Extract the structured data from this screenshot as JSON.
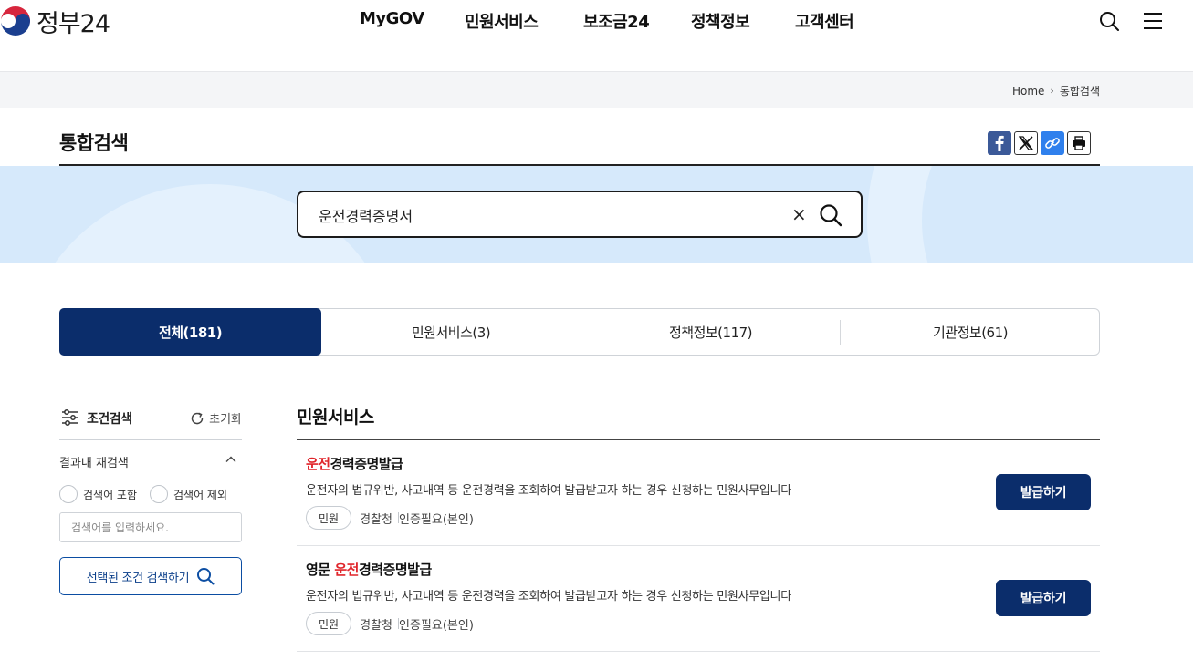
{
  "header": {
    "logo_text": "정부24",
    "nav": [
      "MyGOV",
      "민원서비스",
      "보조금24",
      "정책정보",
      "고객센터"
    ],
    "icons": [
      "search-icon",
      "menu-icon"
    ]
  },
  "breadcrumb": {
    "home": "Home",
    "current": "통합검색"
  },
  "page": {
    "title": "통합검색",
    "share_icons": [
      "facebook-icon",
      "x-icon",
      "link-icon",
      "print-icon"
    ]
  },
  "search": {
    "value": "운전경력증명서"
  },
  "tabs": [
    {
      "label": "전체(181)",
      "active": true
    },
    {
      "label": "민원서비스(3)",
      "active": false
    },
    {
      "label": "정책정보(117)",
      "active": false
    },
    {
      "label": "기관정보(61)",
      "active": false
    }
  ],
  "filter": {
    "title": "조건검색",
    "reset_label": "초기화",
    "refine_label": "결과내 재검색",
    "radio_include": "검색어 포함",
    "radio_exclude": "검색어 제외",
    "input_placeholder": "검색어를 입력하세요.",
    "submit_label": "선택된 조건 검색하기"
  },
  "results_section": {
    "title": "민원서비스",
    "items": [
      {
        "title_prefix": "",
        "title_highlight": "운전",
        "title_rest": "경력증명발급",
        "description": "운전자의 법규위반, 사고내역 등 운전경력을 조회하여 발급받고자 하는 경우 신청하는 민원사무입니다",
        "badge": "민원",
        "agency": "경찰청",
        "auth": "인증필요(본인)",
        "button": "발급하기"
      },
      {
        "title_prefix": "영문 ",
        "title_highlight": "운전",
        "title_rest": "경력증명발급",
        "description": "운전자의 법규위반, 사고내역 등 운전경력을 조회하여 발급받고자 하는 경우 신청하는 민원사무입니다",
        "badge": "민원",
        "agency": "경찰청",
        "auth": "인증필요(본인)",
        "button": "발급하기"
      }
    ]
  },
  "colors": {
    "primary": "#0b2d6b",
    "highlight": "#e0252b",
    "band": "#d6e9fb",
    "facebook": "#3b5998",
    "link": "#2f80ed"
  }
}
